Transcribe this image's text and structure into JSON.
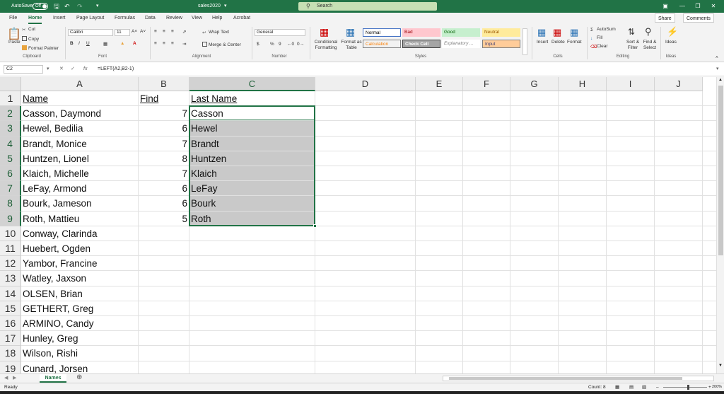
{
  "title_bar": {
    "autosave_label": "AutoSave",
    "autosave_state": "Off",
    "file_title": "sales2020",
    "search_placeholder": "Search"
  },
  "menu": {
    "tabs": [
      "File",
      "Home",
      "Insert",
      "Page Layout",
      "Formulas",
      "Data",
      "Review",
      "View",
      "Help",
      "Acrobat"
    ],
    "active_tab": "Home",
    "share_label": "Share",
    "comments_label": "Comments"
  },
  "ribbon": {
    "clipboard": {
      "paste": "Paste",
      "cut": "Cut",
      "copy": "Copy",
      "format_painter": "Format Painter",
      "label": "Clipboard"
    },
    "font": {
      "name": "Calibri",
      "size": "11",
      "bold": "B",
      "italic": "I",
      "underline": "U",
      "label": "Font"
    },
    "alignment": {
      "wrap_text": "Wrap Text",
      "merge_center": "Merge & Center",
      "label": "Alignment"
    },
    "number": {
      "format": "General",
      "currency": "$",
      "percent": "%",
      "comma": "9",
      "label": "Number"
    },
    "styles": {
      "conditional": "Conditional Formatting",
      "format_table": "Format as Table",
      "cells": [
        {
          "label": "Normal",
          "bg": "#ffffff",
          "fg": "#000000",
          "border": "#4472c4"
        },
        {
          "label": "Bad",
          "bg": "#ffc7ce",
          "fg": "#9c0006"
        },
        {
          "label": "Good",
          "bg": "#c6efce",
          "fg": "#006100"
        },
        {
          "label": "Neutral",
          "bg": "#ffeb9c",
          "fg": "#9c5700"
        },
        {
          "label": "Calculation",
          "bg": "#f2f2f2",
          "fg": "#fa7d00",
          "border": "#7f7f7f"
        },
        {
          "label": "Check Cell",
          "bg": "#a5a5a5",
          "fg": "#ffffff",
          "border": "#3f3f3f"
        },
        {
          "label": "Explanatory ...",
          "bg": "#ffffff",
          "fg": "#7f7f7f"
        },
        {
          "label": "Input",
          "bg": "#ffcc99",
          "fg": "#3f3f76",
          "border": "#7f7f7f"
        }
      ],
      "label": "Styles"
    },
    "cells": {
      "insert": "Insert",
      "delete": "Delete",
      "format": "Format",
      "label": "Cells"
    },
    "editing": {
      "autosum": "AutoSum",
      "fill": "Fill",
      "clear": "Clear",
      "sort_filter": "Sort & Filter",
      "find_select": "Find & Select",
      "label": "Editing"
    },
    "ideas": {
      "label_btn": "Ideas",
      "label": "Ideas"
    }
  },
  "formula_bar": {
    "name_box": "C2",
    "fx": "fx",
    "formula": "=LEFT(A2,B2-1)"
  },
  "sheet": {
    "columns": [
      "A",
      "B",
      "C",
      "D",
      "E",
      "F",
      "G",
      "H",
      "I",
      "J"
    ],
    "selected_column": "C",
    "rows": [
      {
        "n": "1",
        "a": "Name",
        "b": "Find",
        "c": "Last Name"
      },
      {
        "n": "2",
        "a": "Casson, Daymond",
        "b": "7",
        "c": "Casson"
      },
      {
        "n": "3",
        "a": "Hewel, Bedilia",
        "b": "6",
        "c": "Hewel"
      },
      {
        "n": "4",
        "a": "Brandt, Monice",
        "b": "7",
        "c": "Brandt"
      },
      {
        "n": "5",
        "a": "Huntzen, Lionel",
        "b": "8",
        "c": "Huntzen"
      },
      {
        "n": "6",
        "a": "Klaich, Michelle",
        "b": "7",
        "c": "Klaich"
      },
      {
        "n": "7",
        "a": "LeFay, Armond",
        "b": "6",
        "c": "LeFay"
      },
      {
        "n": "8",
        "a": "Bourk, Jameson",
        "b": "6",
        "c": "Bourk"
      },
      {
        "n": "9",
        "a": "Roth, Mattieu",
        "b": "5",
        "c": "Roth"
      },
      {
        "n": "10",
        "a": "Conway, Clarinda",
        "b": "",
        "c": ""
      },
      {
        "n": "11",
        "a": "Huebert, Ogden",
        "b": "",
        "c": ""
      },
      {
        "n": "12",
        "a": "Yambor, Francine",
        "b": "",
        "c": ""
      },
      {
        "n": "13",
        "a": "Watley, Jaxson",
        "b": "",
        "c": ""
      },
      {
        "n": "14",
        "a": "OLSEN, Brian",
        "b": "",
        "c": ""
      },
      {
        "n": "15",
        "a": "GETHERT, Greg",
        "b": "",
        "c": ""
      },
      {
        "n": "16",
        "a": "ARMINO, Candy",
        "b": "",
        "c": ""
      },
      {
        "n": "17",
        "a": "Hunley, Greg",
        "b": "",
        "c": ""
      },
      {
        "n": "18",
        "a": "Wilson, Rishi",
        "b": "",
        "c": ""
      },
      {
        "n": "19",
        "a": "Cunard, Jorsen",
        "b": "",
        "c": ""
      }
    ]
  },
  "sheet_tabs": {
    "active": "Names"
  },
  "status": {
    "ready": "Ready",
    "count": "Count: 8",
    "zoom": "200%"
  },
  "colors": {
    "accent": "#217346",
    "selection": "#c9c9c9"
  }
}
